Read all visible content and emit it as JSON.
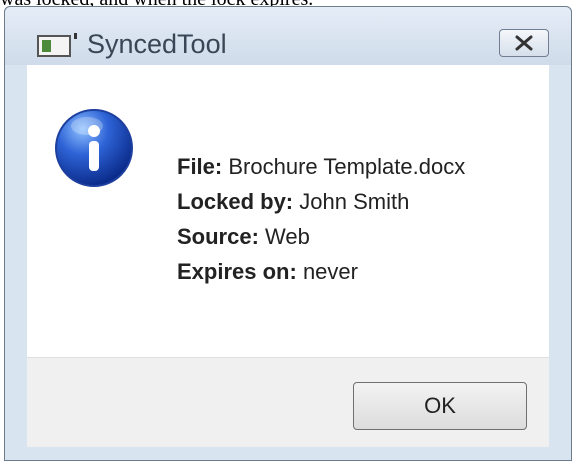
{
  "page": {
    "top_text": "was locked, and when the lock expires."
  },
  "window": {
    "title": "SyncedTool"
  },
  "details": {
    "file_label": "File:",
    "file_value": "Brochure Template.docx",
    "locked_by_label": "Locked by:",
    "locked_by_value": "John Smith",
    "source_label": "Source:",
    "source_value": "Web",
    "expires_label": "Expires on:",
    "expires_value": "never"
  },
  "buttons": {
    "ok_label": "OK"
  },
  "icons": {
    "app": "app-window-icon",
    "info": "info-icon",
    "close": "close-icon"
  }
}
